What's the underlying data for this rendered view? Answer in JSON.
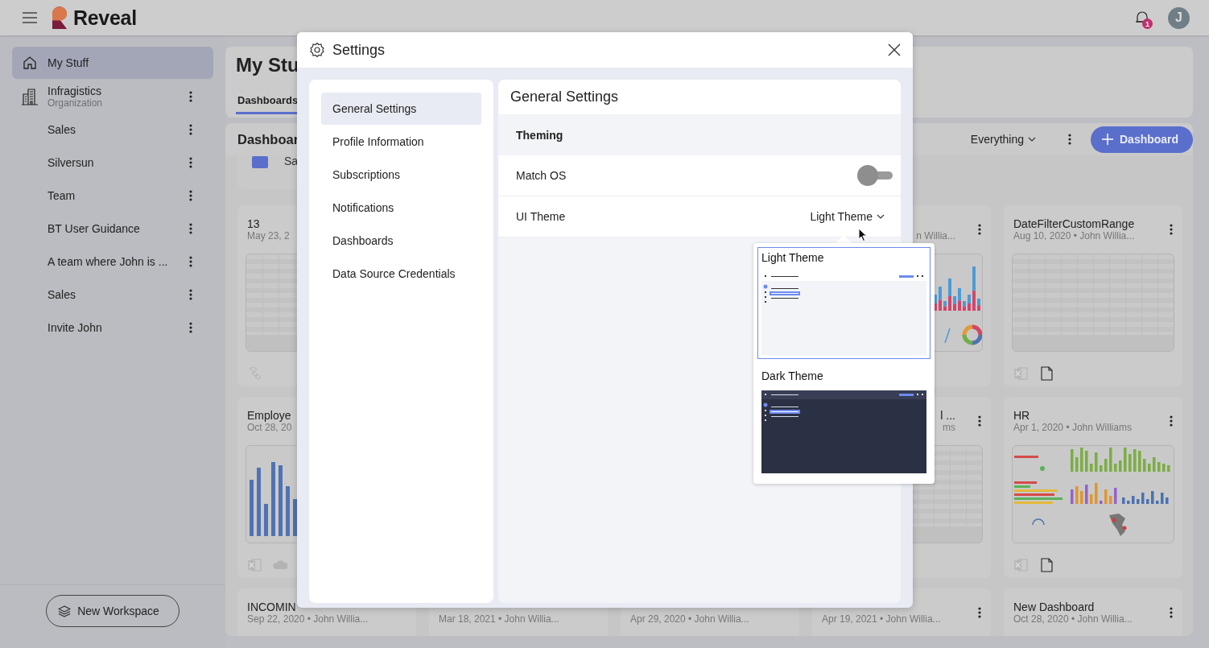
{
  "app": {
    "logo": "Reveal",
    "notification_count": "1",
    "avatar": "J"
  },
  "sidebar": {
    "items": [
      {
        "label": "My Stuff",
        "kind": "home",
        "selected": true
      },
      {
        "label": "Infragistics",
        "sublabel": "Organization",
        "kind": "organization",
        "selected": false
      },
      {
        "label": "Sales",
        "kind": "workspace",
        "selected": false
      },
      {
        "label": "Silversun",
        "kind": "workspace",
        "selected": false
      },
      {
        "label": "Team",
        "kind": "workspace",
        "selected": false
      },
      {
        "label": "BT User Guidance",
        "kind": "workspace",
        "selected": false
      },
      {
        "label": "A team where John is ...",
        "kind": "workspace",
        "selected": false
      },
      {
        "label": "Sales",
        "kind": "workspace",
        "selected": false
      },
      {
        "label": "Invite John",
        "kind": "workspace",
        "selected": false
      }
    ],
    "new_workspace": "New Workspace"
  },
  "header": {
    "title": "My Stu",
    "tabs": [
      {
        "label": "Dashboards",
        "selected": true
      }
    ]
  },
  "toolbar": {
    "title": "Dashboar",
    "filter": "Everything",
    "add_button": "Dashboard"
  },
  "group": {
    "label": "Sa"
  },
  "card_rows": [
    {
      "left": {
        "title": "13",
        "subtitle": "May 23, 2",
        "thumbnail": {
          "kind": "grid"
        },
        "sources": [
          {
            "kind": "cubes"
          }
        ]
      },
      "right": [
        {
          "kind": "partial",
          "subtitle": "n Willia...",
          "menu": true,
          "thumbnail": {
            "kind": "mixed"
          }
        },
        {
          "kind": "full",
          "title": "DateFilterCustomRange",
          "subtitle": "Aug 10, 2020 • John Willia...",
          "menu": true,
          "thumbnail": {
            "kind": "grid"
          },
          "sources": [
            {
              "kind": "excel"
            },
            {
              "kind": "file"
            }
          ]
        }
      ]
    },
    {
      "left": {
        "title": "Employe",
        "subtitle": "Oct 28, 20",
        "thumbnail": {
          "kind": "bars"
        },
        "sources": [
          {
            "kind": "excel"
          },
          {
            "kind": "cloud"
          }
        ]
      },
      "right": [
        {
          "kind": "partial",
          "title": "l ...",
          "subtitle": "ms",
          "menu": true,
          "thumbnail": {
            "kind": "grid"
          }
        },
        {
          "kind": "full",
          "title": "HR",
          "subtitle": "Apr 1, 2020 • John Williams",
          "menu": true,
          "thumbnail": {
            "kind": "dashboard"
          },
          "sources": [
            {
              "kind": "excel"
            },
            {
              "kind": "file"
            }
          ]
        }
      ]
    },
    {
      "left": {
        "title": "INCOMIN",
        "subtitle": "Sep 22, 2020 • John Willia..."
      },
      "right": [
        {
          "kind": "full",
          "subtitle": "Mar 18, 2021 • John Willia..."
        },
        {
          "kind": "full",
          "subtitle": "Apr 29, 2020 • John Willia..."
        },
        {
          "kind": "full",
          "subtitle": "Apr 19, 2021 • John Willia...",
          "menu": true
        },
        {
          "kind": "full",
          "title": "New Dashboard",
          "subtitle": "Oct 28, 2020 • John Willia...",
          "menu": true
        }
      ]
    }
  ],
  "settings": {
    "title": "Settings",
    "nav": [
      {
        "label": "General Settings",
        "selected": true
      },
      {
        "label": "Profile Information",
        "selected": false
      },
      {
        "label": "Subscriptions",
        "selected": false
      },
      {
        "label": "Notifications",
        "selected": false
      },
      {
        "label": "Dashboards",
        "selected": false
      },
      {
        "label": "Data Source Credentials",
        "selected": false
      }
    ],
    "panel_title": "General Settings",
    "section": "Theming",
    "rows": [
      {
        "kind": "toggle",
        "label": "Match OS",
        "on": false
      },
      {
        "kind": "dropdown",
        "label": "UI Theme",
        "value": "Light Theme"
      }
    ],
    "theme_menu": [
      {
        "label": "Light Theme",
        "kind": "light",
        "selected": true
      },
      {
        "label": "Dark Theme",
        "kind": "dark",
        "selected": false
      }
    ]
  }
}
